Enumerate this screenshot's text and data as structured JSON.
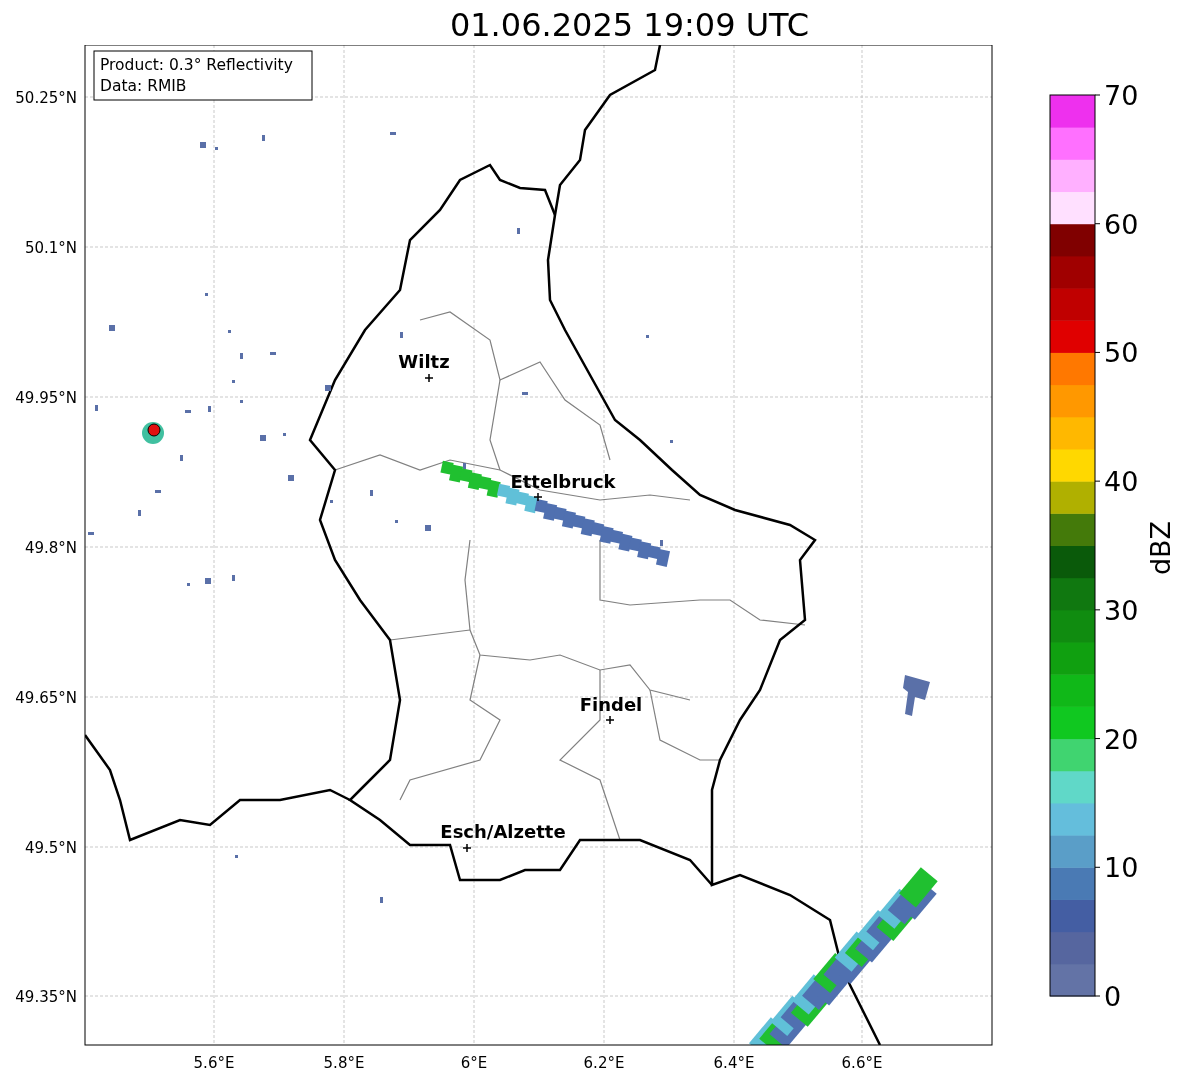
{
  "title": "01.06.2025 19:09 UTC",
  "info": [
    "Product: 0.3° Reflectivity",
    "Data: RMIB"
  ],
  "lat_ticks": [
    "50.25°N",
    "50.1°N",
    "49.95°N",
    "49.8°N",
    "49.65°N",
    "49.5°N",
    "49.35°N"
  ],
  "lon_ticks": [
    "5.6°E",
    "5.8°E",
    "6°E",
    "6.2°E",
    "6.4°E",
    "6.6°E"
  ],
  "cities": [
    {
      "name": "Wiltz"
    },
    {
      "name": "Ettelbruck"
    },
    {
      "name": "Findel"
    },
    {
      "name": "Esch/Alzette"
    }
  ],
  "colorbar": {
    "label": "dBZ",
    "ticks": [
      "70",
      "60",
      "50",
      "40",
      "30",
      "20",
      "10",
      "0"
    ],
    "segments": [
      {
        "color": "#6373a6"
      },
      {
        "color": "#56669f"
      },
      {
        "color": "#445ea3"
      },
      {
        "color": "#4a7ab4"
      },
      {
        "color": "#5a9ec8"
      },
      {
        "color": "#64bedc"
      },
      {
        "color": "#60d8c8"
      },
      {
        "color": "#40d470"
      },
      {
        "color": "#10c820"
      },
      {
        "color": "#10b818"
      },
      {
        "color": "#10a010"
      },
      {
        "color": "#108c10"
      },
      {
        "color": "#107810"
      },
      {
        "color": "#0a5a0a"
      },
      {
        "color": "#447a0a"
      },
      {
        "color": "#b0b000"
      },
      {
        "color": "#ffd800"
      },
      {
        "color": "#ffb800"
      },
      {
        "color": "#ff9800"
      },
      {
        "color": "#ff7800"
      },
      {
        "color": "#e00000"
      },
      {
        "color": "#c00000"
      },
      {
        "color": "#a00000"
      },
      {
        "color": "#800000"
      },
      {
        "color": "#ffe0ff"
      },
      {
        "color": "#ffb0ff"
      },
      {
        "color": "#ff70ff"
      },
      {
        "color": "#ee30ee"
      }
    ]
  }
}
